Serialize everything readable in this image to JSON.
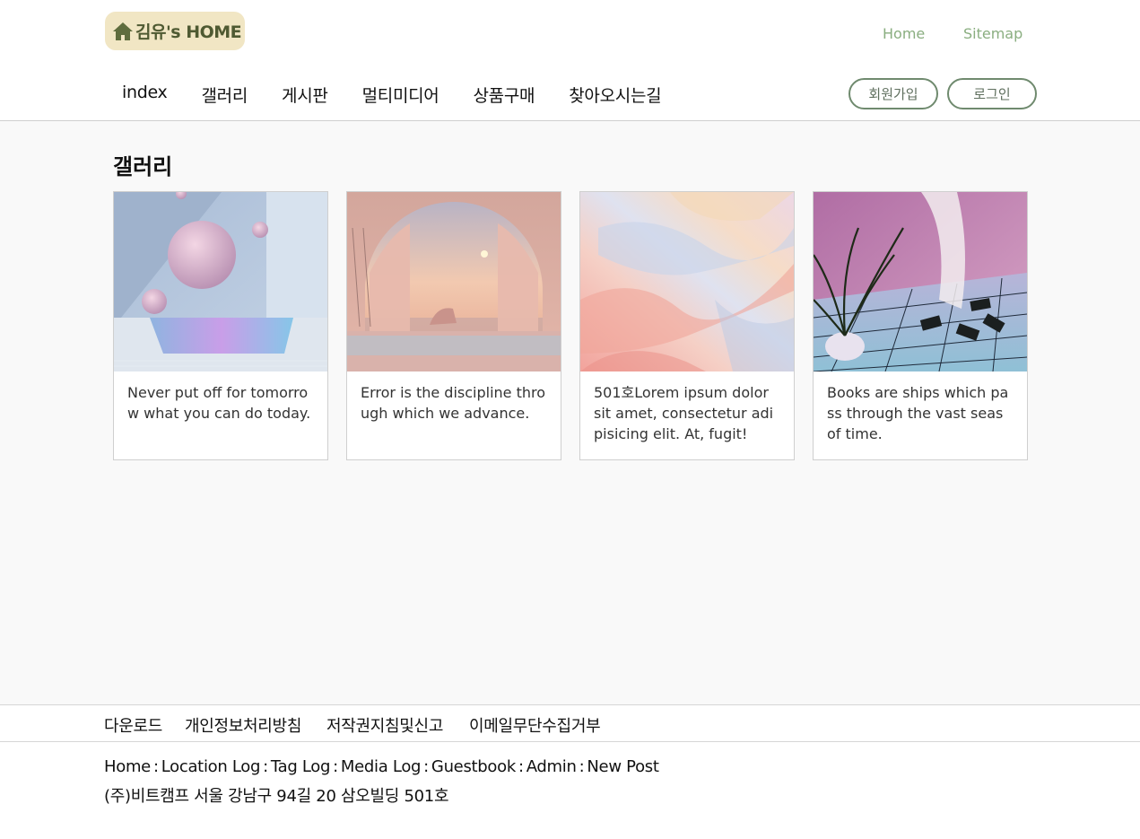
{
  "header": {
    "logo_text": "김유's HOME",
    "util_links": {
      "home": "Home",
      "sitemap": "Sitemap"
    },
    "nav": [
      "index",
      "갤러리",
      "게시판",
      "멀티미디어",
      "상품구매",
      "찾아오시는길"
    ],
    "join_label": "회원가입",
    "login_label": "로그인"
  },
  "main": {
    "title": "갤러리",
    "cards": [
      {
        "text": "Never put off for tomorrow what you can do today."
      },
      {
        "text": "Error is the discipline through which we advance."
      },
      {
        "text": "501호Lorem ipsum dolor sit amet, consectetur adipisicing elit. At, fugit!"
      },
      {
        "text": "Books are ships which pass through the vast seas of time."
      }
    ]
  },
  "footer": {
    "links": [
      "다운로드",
      "개인정보처리방침",
      "저작권지침및신고",
      "이메일무단수집거부"
    ],
    "nav": [
      "Home",
      "Location Log",
      "Tag Log",
      "Media Log",
      "Guestbook",
      "Admin",
      "New Post"
    ],
    "nav_sep": ":",
    "address": "(주)비트캠프 서울 강남구 94길 20 삼오빌딩 501호"
  },
  "colors": {
    "accent_green": "#6f8a6e",
    "util_link": "#8aae80",
    "logo_bg": "#f1e6c4",
    "logo_text": "#4f5a32"
  },
  "icons": {
    "logo": "house-icon"
  }
}
